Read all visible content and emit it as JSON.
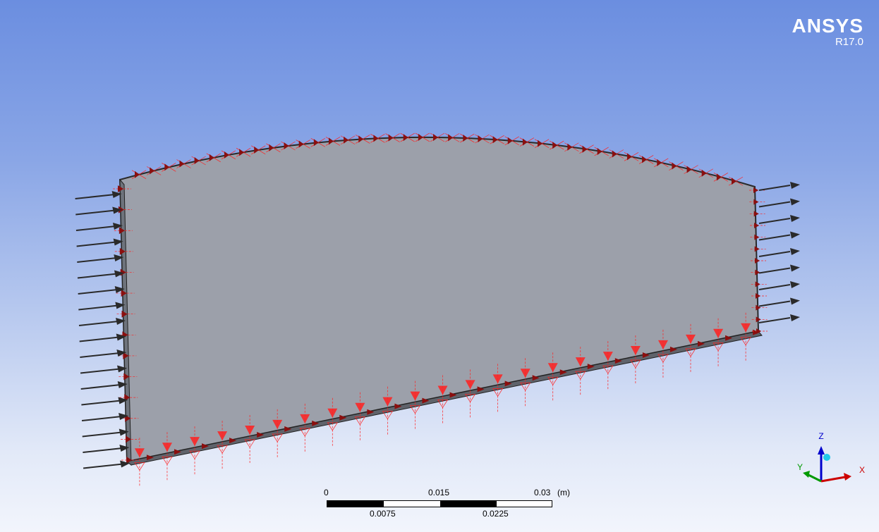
{
  "logo": {
    "brand": "ANSYS",
    "version": "R17.0"
  },
  "scale_bar": {
    "top_labels": [
      "0",
      "0.015",
      "0.03"
    ],
    "unit": "(m)",
    "bottom_labels": [
      "0.0075",
      "0.0225"
    ]
  },
  "triad": {
    "x": "X",
    "y": "Y",
    "z": "Z"
  },
  "colors": {
    "face": "#9ca0aa",
    "support": "#ff2020",
    "force_arrow": "#2a2a2a",
    "triad_x": "#cc0000",
    "triad_y": "#009900",
    "triad_z": "#0000cc"
  }
}
